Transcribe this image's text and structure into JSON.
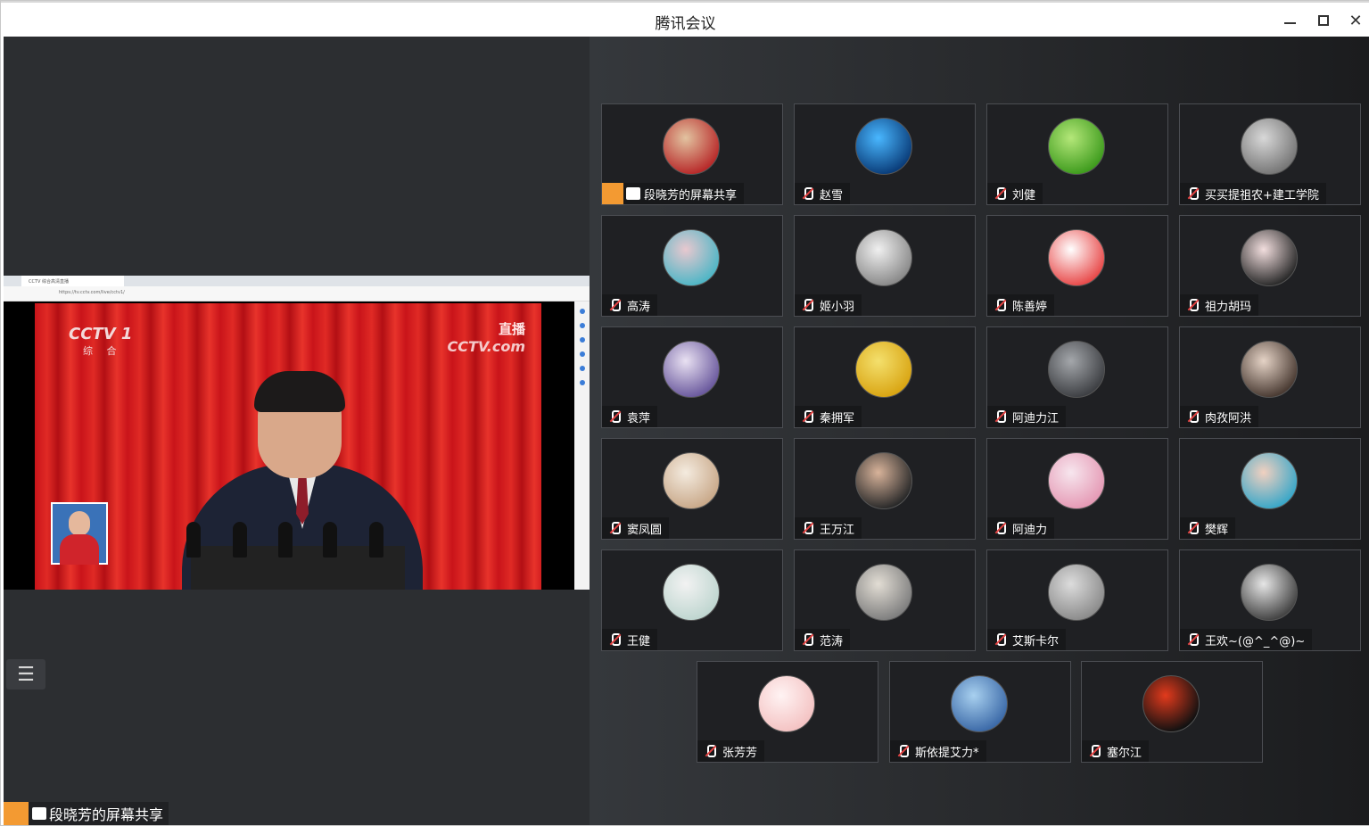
{
  "window": {
    "title": "腾讯会议"
  },
  "shared_screen": {
    "browser_tab_title": "CCTV 综合高清直播",
    "browser_url": "https://tv.cctv.com/live/cctv1/",
    "channel_logo": "CCTV 1",
    "channel_sub": "综 合",
    "live_label": "直播",
    "live_site": "CCTV.com",
    "presenter_label": "段晓芳的屏幕共享"
  },
  "participants": [
    {
      "name": "段晓芳的屏幕共享",
      "sharing": true,
      "avatar_colors": [
        "#b82a2a",
        "#e2c3a0"
      ]
    },
    {
      "name": "赵雪",
      "avatar_colors": [
        "#0a3d7a",
        "#49b7ff"
      ]
    },
    {
      "name": "刘健",
      "avatar_colors": [
        "#3f9c1e",
        "#b4e779"
      ]
    },
    {
      "name": "买买提祖农+建工学院",
      "avatar_colors": [
        "#777777",
        "#d8d8d8"
      ]
    },
    {
      "name": "高涛",
      "avatar_colors": [
        "#4fb6c6",
        "#e8c8cf"
      ]
    },
    {
      "name": "姬小羽",
      "avatar_colors": [
        "#8a8a8a",
        "#f0f0f0"
      ]
    },
    {
      "name": "陈善婷",
      "avatar_colors": [
        "#e84a4a",
        "#ffffff"
      ]
    },
    {
      "name": "祖力胡玛",
      "avatar_colors": [
        "#2b2b2b",
        "#f2dede"
      ]
    },
    {
      "name": "袁萍",
      "avatar_colors": [
        "#6b5a9e",
        "#e9e1f2"
      ]
    },
    {
      "name": "秦拥军",
      "avatar_colors": [
        "#d9a513",
        "#f4e06d"
      ]
    },
    {
      "name": "阿迪力江",
      "avatar_colors": [
        "#3e4044",
        "#a4a7ab"
      ]
    },
    {
      "name": "肉孜阿洪",
      "avatar_colors": [
        "#4a3b33",
        "#e5d3c6"
      ]
    },
    {
      "name": "窦凤圆",
      "avatar_colors": [
        "#c9a98a",
        "#f4ebdf"
      ]
    },
    {
      "name": "王万江",
      "avatar_colors": [
        "#2a2a2a",
        "#d8b39a"
      ]
    },
    {
      "name": "阿迪力",
      "avatar_colors": [
        "#e59ab5",
        "#f7e6ee"
      ]
    },
    {
      "name": "樊辉",
      "avatar_colors": [
        "#3aa7c8",
        "#f1d0c0"
      ]
    },
    {
      "name": "王健",
      "avatar_colors": [
        "#bfd6d0",
        "#f2f2f2"
      ]
    },
    {
      "name": "范涛",
      "avatar_colors": [
        "#7f7f7f",
        "#e2ddd4"
      ]
    },
    {
      "name": "艾斯卡尔",
      "avatar_colors": [
        "#8c8c8c",
        "#dcdcdc"
      ]
    },
    {
      "name": "王欢~(@^_^@)~",
      "avatar_colors": [
        "#444444",
        "#e6e6e6"
      ]
    },
    {
      "name": "张芳芳",
      "avatar_colors": [
        "#f4c3c3",
        "#fff3f3"
      ]
    },
    {
      "name": "斯依提艾力*",
      "avatar_colors": [
        "#3c6aa8",
        "#a8d0ef"
      ]
    },
    {
      "name": "塞尔江",
      "avatar_colors": [
        "#111111",
        "#e23a1c"
      ]
    }
  ]
}
